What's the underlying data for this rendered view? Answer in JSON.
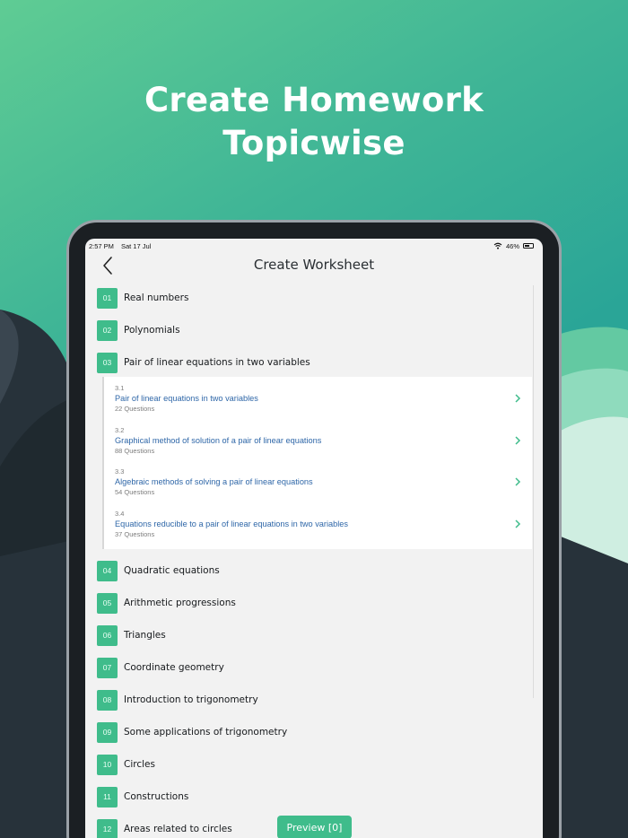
{
  "headline": {
    "line1": "Create Homework",
    "line2": "Topicwise"
  },
  "status_bar": {
    "time": "2:57 PM",
    "date": "Sat 17 Jul",
    "battery": "46%"
  },
  "nav": {
    "title": "Create Worksheet"
  },
  "chapters": [
    {
      "num": "01",
      "title": "Real numbers"
    },
    {
      "num": "02",
      "title": "Polynomials"
    },
    {
      "num": "03",
      "title": "Pair of linear equations in two variables"
    },
    {
      "num": "04",
      "title": "Quadratic equations"
    },
    {
      "num": "05",
      "title": "Arithmetic progressions"
    },
    {
      "num": "06",
      "title": "Triangles"
    },
    {
      "num": "07",
      "title": "Coordinate geometry"
    },
    {
      "num": "08",
      "title": "Introduction to trigonometry"
    },
    {
      "num": "09",
      "title": "Some applications of trigonometry"
    },
    {
      "num": "10",
      "title": "Circles"
    },
    {
      "num": "11",
      "title": "Constructions"
    },
    {
      "num": "12",
      "title": "Areas related to circles"
    }
  ],
  "subtopics": [
    {
      "num": "3.1",
      "title": "Pair of linear equations in two variables",
      "count": "22 Questions"
    },
    {
      "num": "3.2",
      "title": "Graphical method of solution of a pair of linear equations",
      "count": "88 Questions"
    },
    {
      "num": "3.3",
      "title": "Algebraic methods of solving a pair of linear equations",
      "count": "54 Questions"
    },
    {
      "num": "3.4",
      "title": "Equations reducible to a pair of linear equations in two variables",
      "count": "37 Questions"
    }
  ],
  "preview_button": {
    "label": "Preview [0]"
  },
  "colors": {
    "accent": "#3fbc8b",
    "link": "#2f67a8",
    "background_top": "#5fcc94",
    "background_dark": "#27323a"
  },
  "icons": {
    "back": "chevron-left-icon",
    "subtopic": "chevron-right-icon",
    "wifi": "wifi-icon",
    "battery": "battery-icon"
  }
}
